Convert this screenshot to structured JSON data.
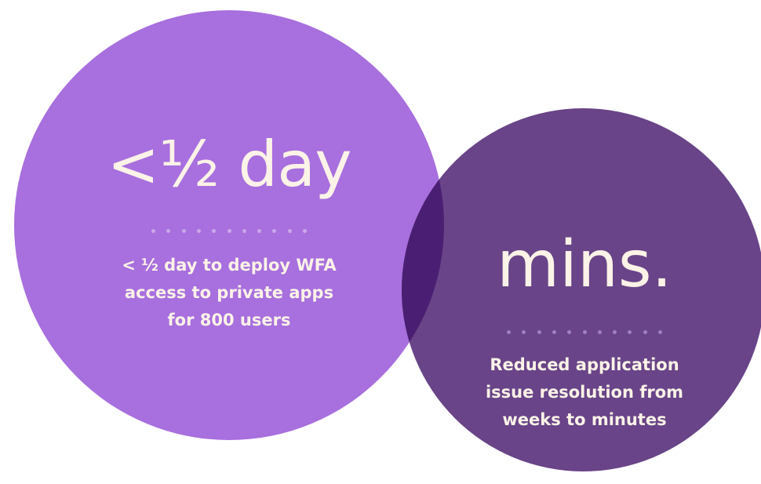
{
  "colors": {
    "background": "#ffffff",
    "circle_left": "#a86fde",
    "circle_right": "#694488",
    "overlap": "#4a1f73",
    "text": "#fbf3e7",
    "dots_left": "#c9a9ea",
    "dots_right": "#9f7fc6"
  },
  "stats": {
    "left": {
      "value": "<½ day",
      "description_lines": [
        "< ½ day to deploy WFA",
        "access to private apps",
        "for 800 users"
      ]
    },
    "right": {
      "value": "mins.",
      "description_lines": [
        "Reduced application",
        "issue resolution from",
        "weeks to minutes"
      ]
    }
  }
}
